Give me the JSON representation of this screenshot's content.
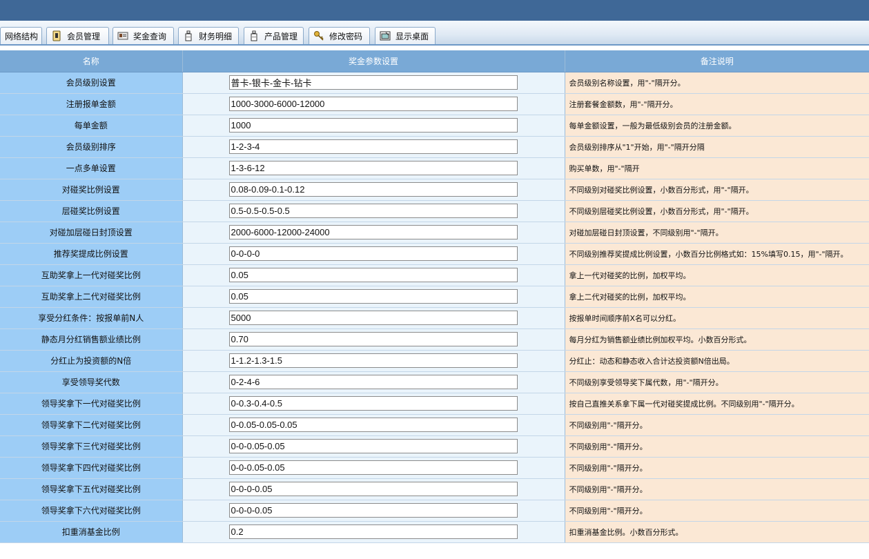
{
  "tabs": [
    {
      "label": "网络结构",
      "icon": "none"
    },
    {
      "label": "会员管理",
      "icon": "member-icon"
    },
    {
      "label": "奖金查询",
      "icon": "card-icon"
    },
    {
      "label": "财务明细",
      "icon": "bottle-icon"
    },
    {
      "label": "产品管理",
      "icon": "bottle-icon"
    },
    {
      "label": "修改密码",
      "icon": "keys-icon"
    },
    {
      "label": "显示桌面",
      "icon": "desktop-icon"
    }
  ],
  "table": {
    "headers": [
      "名称",
      "奖金参数设置",
      "备注说明"
    ],
    "rows": [
      {
        "name": "会员级别设置",
        "value": "普卡-银卡-金卡-钻卡",
        "note": "会员级别名称设置，用\"-\"隔开分。"
      },
      {
        "name": "注册报单金额",
        "value": "1000-3000-6000-12000",
        "note": "注册套餐金额数，用\"-\"隔开分。"
      },
      {
        "name": "每单金额",
        "value": "1000",
        "note": "每单金额设置，一般为最低级别会员的注册金额。"
      },
      {
        "name": "会员级别排序",
        "value": "1-2-3-4",
        "note": "会员级别排序从\"1\"开始，用\"-\"隔开分隔"
      },
      {
        "name": "一点多单设置",
        "value": "1-3-6-12",
        "note": "购买单数，用\"-\"隔开"
      },
      {
        "name": "对碰奖比例设置",
        "value": "0.08-0.09-0.1-0.12",
        "note": "不同级别对碰奖比例设置，小数百分形式，用\"-\"隔开。"
      },
      {
        "name": "层碰奖比例设置",
        "value": "0.5-0.5-0.5-0.5",
        "note": "不同级别层碰奖比例设置，小数百分形式，用\"-\"隔开。"
      },
      {
        "name": "对碰加层碰日封顶设置",
        "value": "2000-6000-12000-24000",
        "note": "对碰加层碰日封顶设置，不同级别用\"-\"隔开。"
      },
      {
        "name": "推荐奖提成比例设置",
        "value": "0-0-0-0",
        "note": "不同级别推荐奖提成比例设置，小数百分比例格式如：15%填写0.15，用\"-\"隔开。"
      },
      {
        "name": "互助奖拿上一代对碰奖比例",
        "value": "0.05",
        "note": "拿上一代对碰奖的比例，加权平均。"
      },
      {
        "name": "互助奖拿上二代对碰奖比例",
        "value": "0.05",
        "note": "拿上二代对碰奖的比例，加权平均。"
      },
      {
        "name": "享受分红条件：按报单前N人",
        "value": "5000",
        "note": "按报单时间顺序前X名可以分红。"
      },
      {
        "name": "静态月分红销售额业绩比例",
        "value": "0.70",
        "note": "每月分红为销售额业绩比例加权平均。小数百分形式。"
      },
      {
        "name": "分红止为投资额的N倍",
        "value": "1-1.2-1.3-1.5",
        "note": "分红止：动态和静态收入合计达投资额N倍出局。"
      },
      {
        "name": "享受领导奖代数",
        "value": "0-2-4-6",
        "note": "不同级别享受领导奖下属代数，用\"-\"隔开分。"
      },
      {
        "name": "领导奖拿下一代对碰奖比例",
        "value": "0-0.3-0.4-0.5",
        "note": "按自己直推关系拿下属一代对碰奖提成比例。不同级别用\"-\"隔开分。"
      },
      {
        "name": "领导奖拿下二代对碰奖比例",
        "value": "0-0.05-0.05-0.05",
        "note": "不同级别用\"-\"隔开分。"
      },
      {
        "name": "领导奖拿下三代对碰奖比例",
        "value": "0-0-0.05-0.05",
        "note": "不同级别用\"-\"隔开分。"
      },
      {
        "name": "领导奖拿下四代对碰奖比例",
        "value": "0-0-0.05-0.05",
        "note": "不同级别用\"-\"隔开分。"
      },
      {
        "name": "领导奖拿下五代对碰奖比例",
        "value": "0-0-0-0.05",
        "note": "不同级别用\"-\"隔开分。"
      },
      {
        "name": "领导奖拿下六代对碰奖比例",
        "value": "0-0-0-0.05",
        "note": "不同级别用\"-\"隔开分。"
      },
      {
        "name": "扣重消基金比例",
        "value": "0.2",
        "note": "扣重消基金比例。小数百分形式。"
      }
    ]
  }
}
